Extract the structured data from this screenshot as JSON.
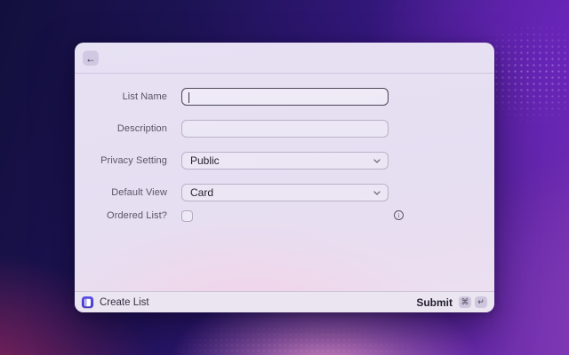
{
  "window": {
    "header": {
      "back_icon": "←"
    },
    "form": {
      "fields": [
        {
          "label": "List Name",
          "type": "text",
          "value": "",
          "focused": true
        },
        {
          "label": "Description",
          "type": "text",
          "value": "",
          "focused": false
        },
        {
          "label": "Privacy Setting",
          "type": "select",
          "value": "Public"
        },
        {
          "label": "Default View",
          "type": "select",
          "value": "Card"
        },
        {
          "label": "Ordered List?",
          "type": "checkbox",
          "checked": false
        }
      ],
      "info_icon_glyph": "i"
    },
    "footer": {
      "app_icon": "book-icon",
      "app_name": "Create List",
      "submit_label": "Submit",
      "shortcuts": [
        "⌘",
        "↵"
      ]
    },
    "colors": {
      "app_icon_purple": "#4f46e5",
      "focus_border": "#4b4559",
      "background_indigo": "#1d1354",
      "background_purple": "#5f24a6",
      "background_magenta": "#9a2762",
      "background_pink_glow": "#d88ac4",
      "window_lavender": "#e6def1"
    }
  }
}
